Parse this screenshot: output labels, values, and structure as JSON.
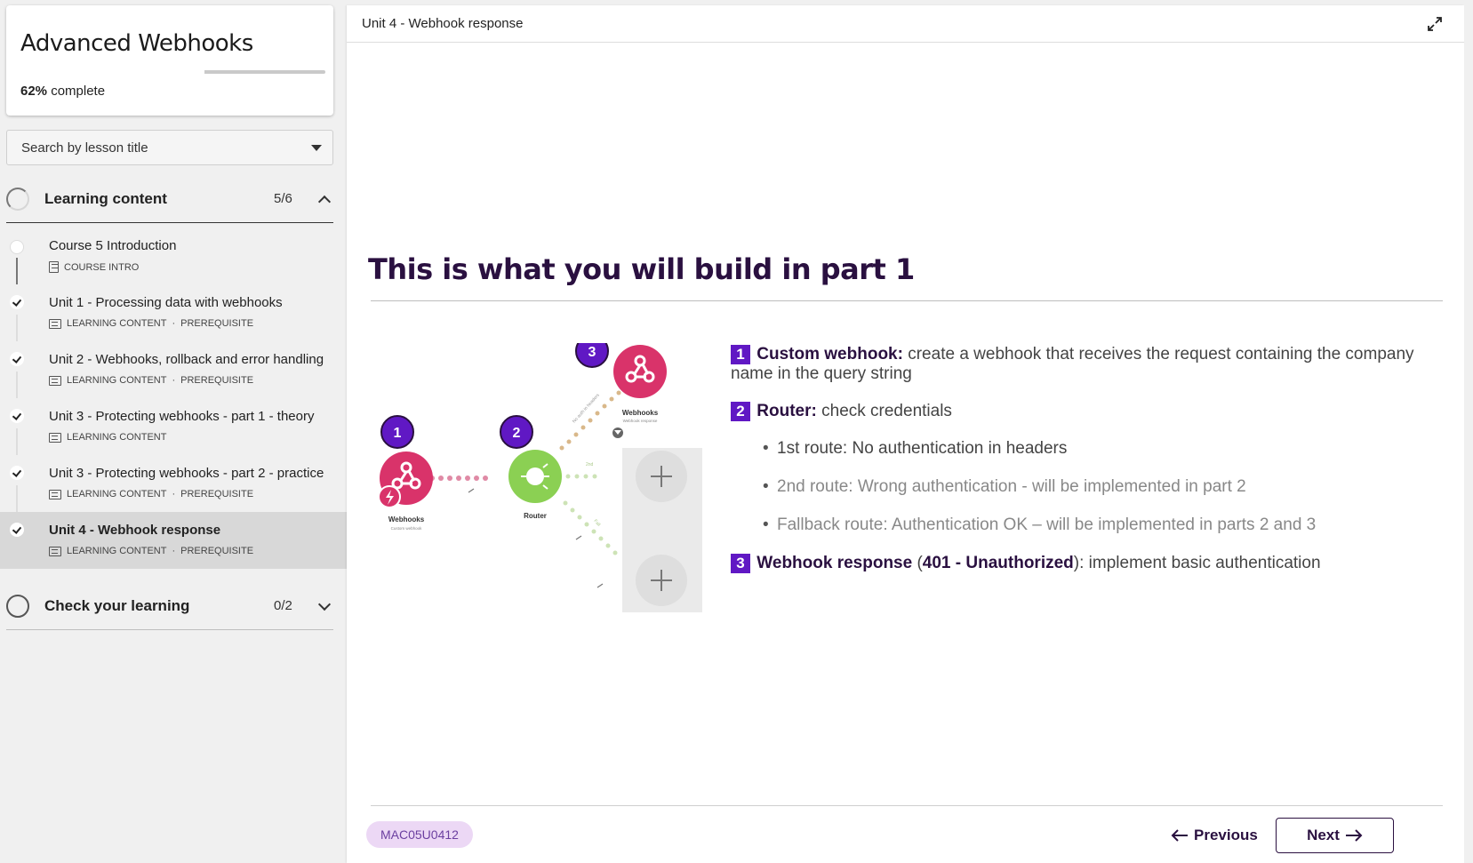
{
  "course": {
    "title": "Advanced Webhooks",
    "progress_percent": "62%",
    "progress_label": "complete",
    "progress_value": 0.62
  },
  "search": {
    "placeholder": "Search by lesson title"
  },
  "sections": [
    {
      "title": "Learning content",
      "count": "5/6",
      "expanded": true
    },
    {
      "title": "Check your learning",
      "count": "0/2",
      "expanded": false
    }
  ],
  "lessons": [
    {
      "title": "Course 5 Introduction",
      "meta": [
        "COURSE INTRO"
      ],
      "completed": false
    },
    {
      "title": "Unit 1 - Processing data with webhooks",
      "meta": [
        "LEARNING CONTENT",
        "PREREQUISITE"
      ],
      "completed": true
    },
    {
      "title": "Unit 2 - Webhooks, rollback and error handling",
      "meta": [
        "LEARNING CONTENT",
        "PREREQUISITE"
      ],
      "completed": true
    },
    {
      "title": "Unit 3 - Protecting webhooks - part 1 - theory",
      "meta": [
        "LEARNING CONTENT"
      ],
      "completed": true
    },
    {
      "title": "Unit 3 - Protecting webhooks - part 2 - practice",
      "meta": [
        "LEARNING CONTENT",
        "PREREQUISITE"
      ],
      "completed": true
    },
    {
      "title": "Unit 4 - Webhook response",
      "meta": [
        "LEARNING CONTENT",
        "PREREQUISITE"
      ],
      "completed": true,
      "active": true
    }
  ],
  "meta_separator": "·",
  "main": {
    "unit_title": "Unit 4 - Webhook response",
    "heading": "This is what you will build in part 1",
    "diagram": {
      "nodes": [
        {
          "num": "1",
          "label": "Webhooks",
          "sublabel": "Custom webhook"
        },
        {
          "num": "2",
          "label": "Router"
        },
        {
          "num": "3",
          "label": "Webhooks",
          "sublabel": "Webhook response"
        }
      ],
      "route_labels": [
        "No auth in headers",
        "2nd",
        "Fall"
      ]
    },
    "steps": {
      "s1_num": "1",
      "s1_bold": "Custom webhook:",
      "s1_text": " create a webhook that receives the request containing the company name in the query string",
      "s2_num": "2",
      "s2_bold": "Router:",
      "s2_text": " check credentials",
      "bullets": [
        "1st route: No authentication in headers",
        "2nd route: Wrong authentication - will be implemented in part 2",
        "Fallback route: Authentication OK – will be implemented in parts 2 and 3"
      ],
      "s3_num": "3",
      "s3_bold": "Webhook response",
      "s3_mid": " (",
      "s3_bold2": "401 - Unauthorized",
      "s3_text": "): implement basic authentication"
    },
    "code": "MAC05U0412",
    "prev_label": "Previous",
    "next_label": "Next",
    "colors": {
      "accent": "#6018c4",
      "heading": "#2a1040",
      "webhook_red": "#d9336a",
      "router_green": "#8bd053"
    }
  }
}
